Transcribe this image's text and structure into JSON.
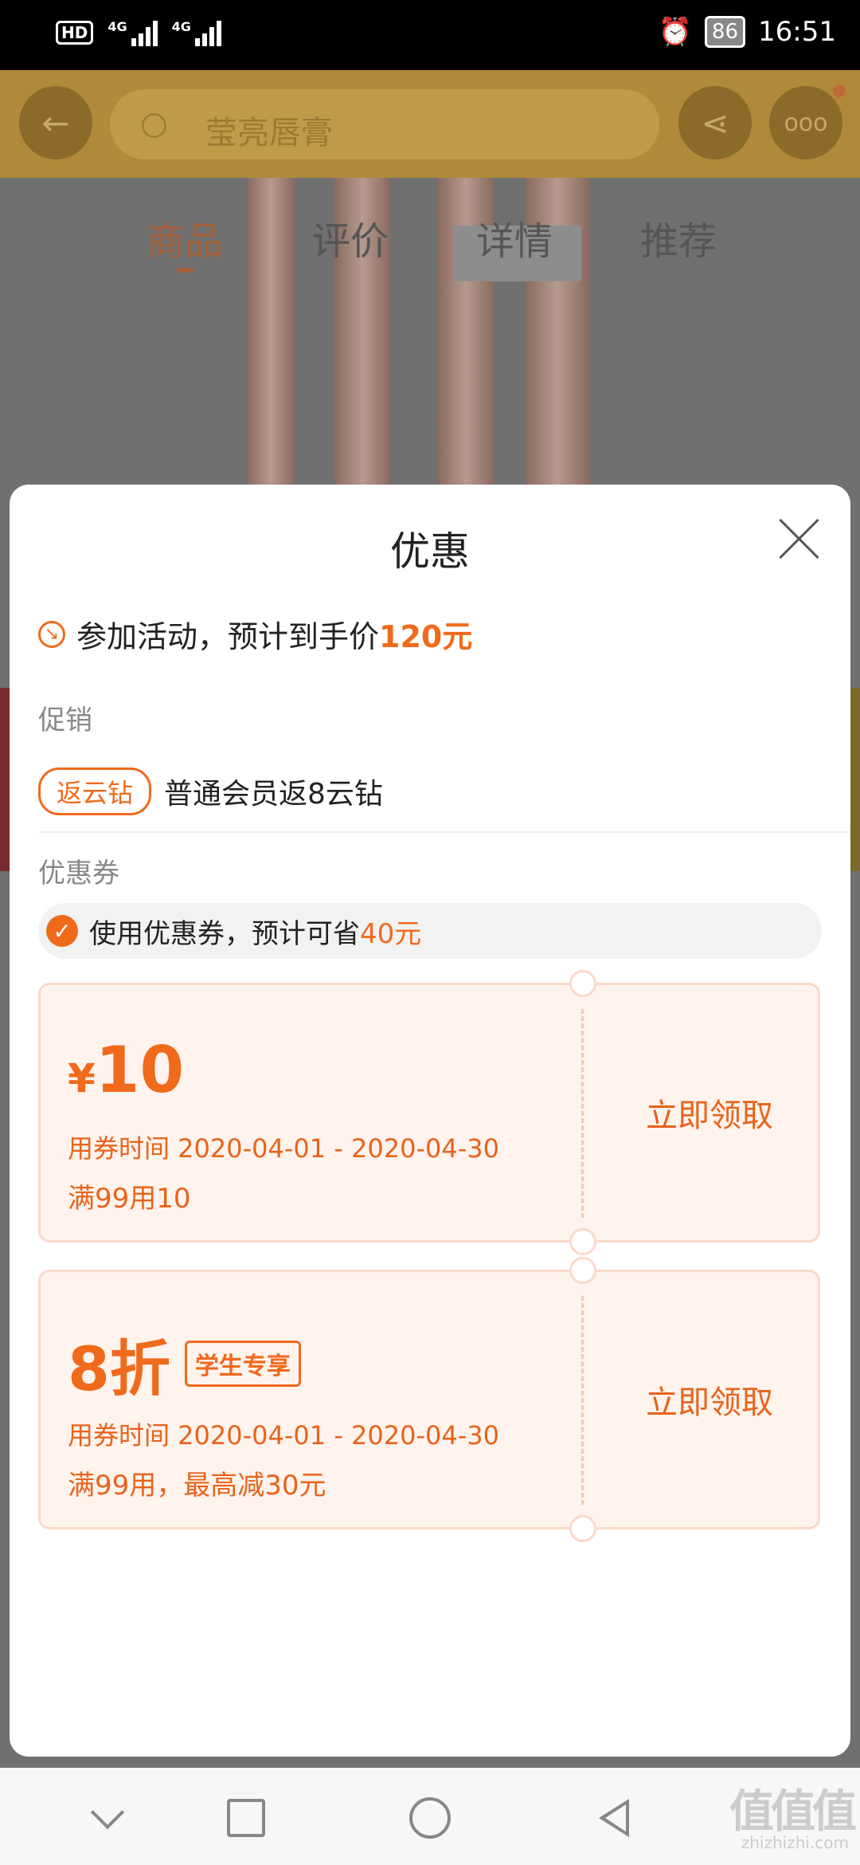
{
  "status_bar": {
    "hd": "HD",
    "net1": "4G",
    "net2": "4G",
    "battery": "86",
    "time": "16:51"
  },
  "product_page": {
    "search_placeholder": "莹亮唇膏",
    "tabs": [
      "商品",
      "评价",
      "详情",
      "推荐"
    ],
    "active_tab": 0
  },
  "sheet": {
    "title": "优惠",
    "activity": {
      "text": "参加活动，预计到手价",
      "price": "120元"
    },
    "promo": {
      "section": "促销",
      "tag": "返云钻",
      "text": "普通会员返8云钻"
    },
    "coupons": {
      "section": "优惠券",
      "use_text": "使用优惠券，预计可省",
      "save_amount": "40元",
      "items": [
        {
          "symbol": "¥",
          "amount": "10",
          "time": "用券时间 2020-04-01 - 2020-04-30",
          "rule": "满99用10",
          "button": "立即领取"
        },
        {
          "discount": "8折",
          "badge": "学生专享",
          "time": "用券时间 2020-04-01 - 2020-04-30",
          "rule": "满99用，最高减30元",
          "button": "立即领取"
        }
      ]
    }
  },
  "watermark": {
    "text": "值值值",
    "sub": "zhizhizhi.com"
  },
  "colors": {
    "accent": "#f06a1b",
    "coupon_bg": "#fff3ee",
    "coupon_border": "#fbd9c8"
  }
}
